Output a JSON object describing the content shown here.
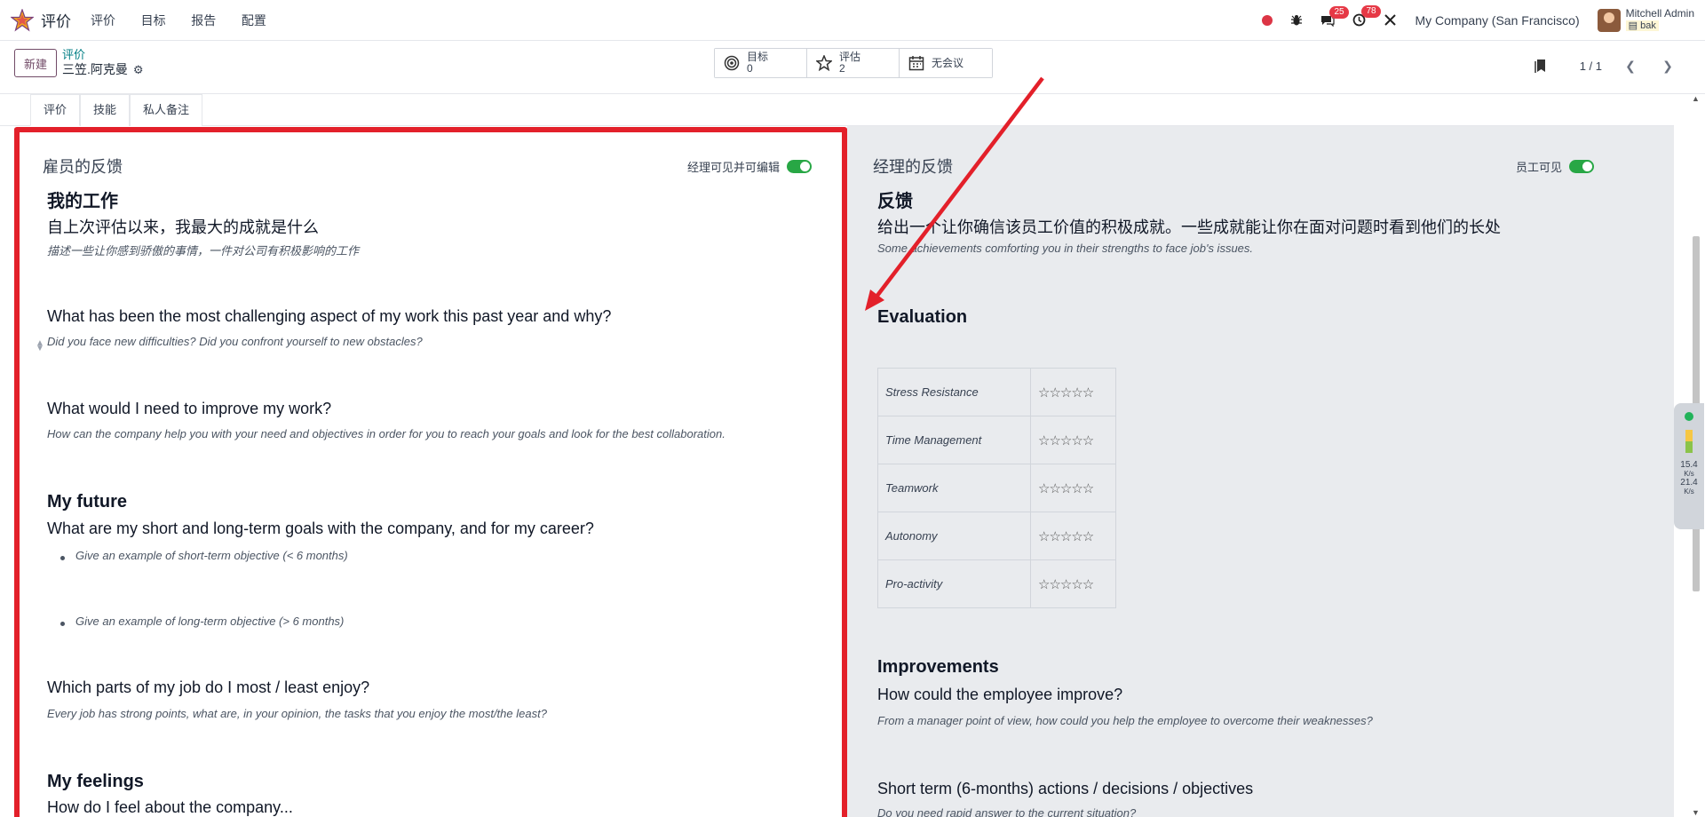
{
  "navbar": {
    "app_name": "评价",
    "menu": [
      "评价",
      "目标",
      "报告",
      "配置"
    ],
    "messages_badge": "25",
    "activities_badge": "78",
    "company": "My Company (San Francisco)",
    "user_name": "Mitchell Admin",
    "user_db": "bak"
  },
  "control_panel": {
    "new_label": "新建",
    "breadcrumb_parent": "评价",
    "breadcrumb_current": "三笠.阿克曼",
    "smart_buttons": {
      "goals_label": "目标",
      "goals_count": "0",
      "appraisals_label": "评估",
      "appraisals_count": "2",
      "meeting_label": "无会议"
    },
    "pager": "1 / 1"
  },
  "tabs": [
    "评价",
    "技能",
    "私人备注"
  ],
  "employee": {
    "heading": "雇员的反馈",
    "toggle_label": "经理可见并可编辑",
    "toggle_on": true,
    "sections": {
      "my_work_title": "我的工作",
      "q1": "自上次评估以来，我最大的成就是什么",
      "h1": "描述一些让你感到骄傲的事情，一件对公司有积极影响的工作",
      "q2": "What has been the most challenging aspect of my work this past year and why?",
      "h2": "Did you face new difficulties? Did you confront yourself to new obstacles?",
      "q3": "What would I need to improve my work?",
      "h3": "How can the company help you with your need and objectives in order for you to reach your goals and look for the best collaboration.",
      "future_title": "My future",
      "q4": "What are my short and long-term goals with the company, and for my career?",
      "b1": "Give an example of short-term objective (< 6 months)",
      "b2": "Give an example of long-term objective (> 6 months)",
      "q5": "Which parts of my job do I most / least enjoy?",
      "h5": "Every job has strong points, what are, in your opinion, the tasks that you enjoy the most/the least?",
      "feelings_title": "My feelings",
      "q6": "How do I feel about the company..."
    }
  },
  "manager": {
    "heading": "经理的反馈",
    "toggle_label": "员工可见",
    "toggle_on": true,
    "feedback_title": "反馈",
    "q1": "给出一个让你确信该员工价值的积极成就。一些成就能让你在面对问题时看到他们的长处",
    "h1": "Some achievements comforting you in their strengths to face job's issues.",
    "evaluation_title": "Evaluation",
    "evaluation_rows": [
      {
        "label": "Stress Resistance",
        "stars": "☆☆☆☆☆"
      },
      {
        "label": "Time Management",
        "stars": "☆☆☆☆☆"
      },
      {
        "label": "Teamwork",
        "stars": "☆☆☆☆☆"
      },
      {
        "label": "Autonomy",
        "stars": "☆☆☆☆☆"
      },
      {
        "label": "Pro-activity",
        "stars": "☆☆☆☆☆"
      }
    ],
    "improvements_title": "Improvements",
    "q2": "How could the employee improve?",
    "h2": "From a manager point of view, how could you help the employee to overcome their weaknesses?",
    "q3": "Short term (6-months) actions / decisions / objectives",
    "h3": "Do you need rapid answer to the current situation?"
  },
  "net_widget": {
    "up": "15.4",
    "up_unit": "K/s",
    "down": "21.4",
    "down_unit": "K/s"
  },
  "colors": {
    "brand": "#714b67",
    "highlight_box": "#e3202a",
    "toggle_on": "#28a745",
    "manager_bg": "#e9ebee"
  }
}
